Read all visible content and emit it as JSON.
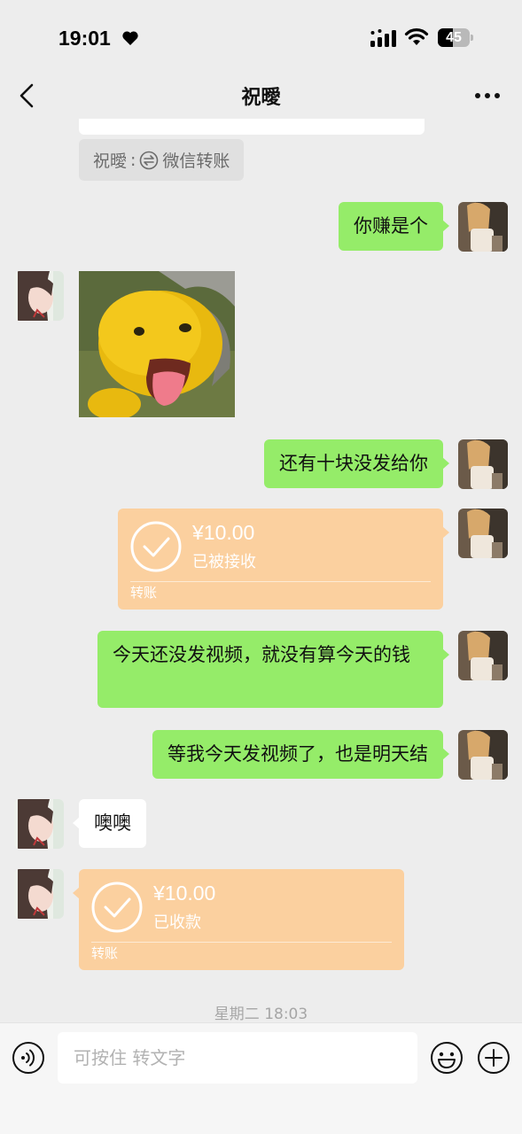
{
  "status_bar": {
    "time": "19:01",
    "battery": "45",
    "icons": [
      "heart-icon",
      "signal-icon",
      "wifi-icon",
      "battery-icon"
    ]
  },
  "header": {
    "title": "祝曖",
    "back_icon": "chevron-left-icon",
    "more_icon": "more-dots-icon"
  },
  "messages": {
    "quote": {
      "sender": "祝曖",
      "separator": ":",
      "text": "微信转账",
      "icon": "exchange-icon"
    },
    "m1": {
      "side": "right",
      "text": "你赚是个"
    },
    "m2": {
      "side": "left",
      "type": "sticker",
      "icon": "yellow-character-sticker"
    },
    "m3": {
      "side": "right",
      "text": "还有十块没发给你"
    },
    "m4": {
      "side": "right",
      "type": "transfer",
      "amount": "¥10.00",
      "status": "已被接收",
      "label": "转账"
    },
    "m5": {
      "side": "right",
      "text": "今天还没发视频，就没有算今天的钱"
    },
    "m6": {
      "side": "right",
      "text": "等我今天发视频了，也是明天结"
    },
    "m7": {
      "side": "left",
      "text": "噢噢"
    },
    "m8": {
      "side": "left",
      "type": "transfer",
      "amount": "¥10.00",
      "status": "已收款",
      "label": "转账"
    }
  },
  "timestamp": "星期二 18:03",
  "input_bar": {
    "placeholder": "可按住 转文字",
    "voice_icon": "voice-icon",
    "emoji_icon": "emoji-icon",
    "add_icon": "plus-icon"
  },
  "colors": {
    "background": "#ededed",
    "sent_bubble": "#95ec69",
    "received_bubble": "#ffffff",
    "transfer_card": "#fbd09f"
  }
}
